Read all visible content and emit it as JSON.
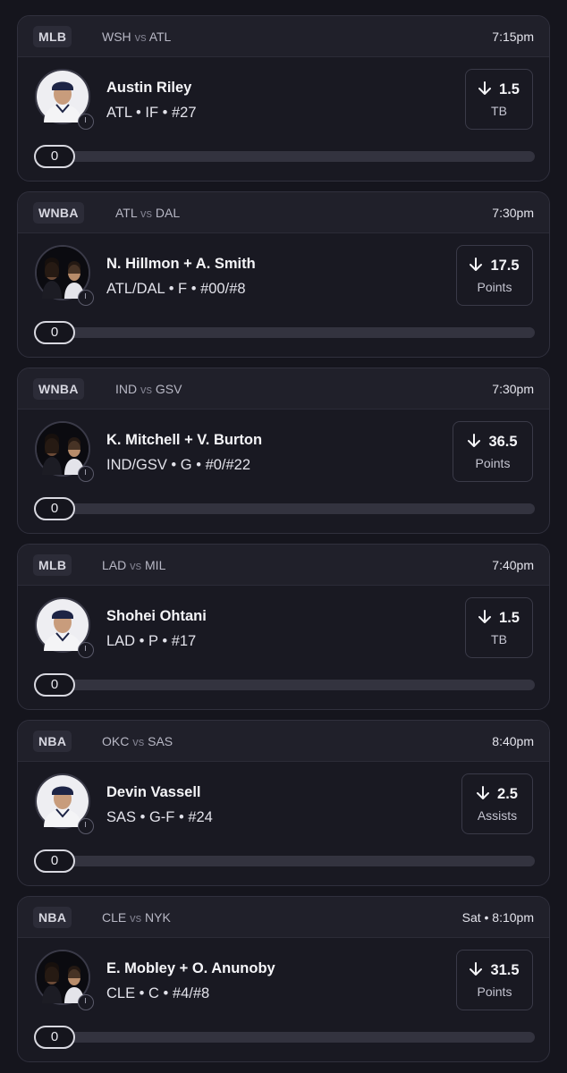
{
  "picks": [
    {
      "league": "MLB",
      "away": "WSH",
      "vs": "vs",
      "home": "ATL",
      "time": "7:15pm",
      "player": "Austin Riley",
      "info": "ATL • IF • #27",
      "line": "1.5",
      "stat": "TB",
      "progress": "0",
      "avatar": "single-player-photo"
    },
    {
      "league": "WNBA",
      "away": "ATL",
      "vs": "vs",
      "home": "DAL",
      "time": "7:30pm",
      "player": "N. Hillmon + A. Smith",
      "info": "ATL/DAL • F • #00/#8",
      "line": "17.5",
      "stat": "Points",
      "progress": "0",
      "avatar": "combo-player-photo"
    },
    {
      "league": "WNBA",
      "away": "IND",
      "vs": "vs",
      "home": "GSV",
      "time": "7:30pm",
      "player": "K. Mitchell + V. Burton",
      "info": "IND/GSV • G • #0/#22",
      "line": "36.5",
      "stat": "Points",
      "progress": "0",
      "avatar": "combo-player-photo"
    },
    {
      "league": "MLB",
      "away": "LAD",
      "vs": "vs",
      "home": "MIL",
      "time": "7:40pm",
      "player": "Shohei Ohtani",
      "info": "LAD • P • #17",
      "line": "1.5",
      "stat": "TB",
      "progress": "0",
      "avatar": "single-player-photo"
    },
    {
      "league": "NBA",
      "away": "OKC",
      "vs": "vs",
      "home": "SAS",
      "time": "8:40pm",
      "player": "Devin Vassell",
      "info": "SAS • G-F • #24",
      "line": "2.5",
      "stat": "Assists",
      "progress": "0",
      "avatar": "single-player-photo"
    },
    {
      "league": "NBA",
      "away": "CLE",
      "vs": "vs",
      "home": "NYK",
      "time": "Sat • 8:10pm",
      "player": "E. Mobley + O. Anunoby",
      "info": "CLE • C • #4/#8",
      "line": "31.5",
      "stat": "Points",
      "progress": "0",
      "avatar": "combo-player-photo"
    }
  ],
  "colors": {
    "background": "#15151d",
    "card": "#191922",
    "header": "#20202a",
    "border": "#30303d",
    "track": "#33333f",
    "text": "#ffffff"
  },
  "icons": [
    "arrow-down-icon",
    "clock-icon"
  ]
}
